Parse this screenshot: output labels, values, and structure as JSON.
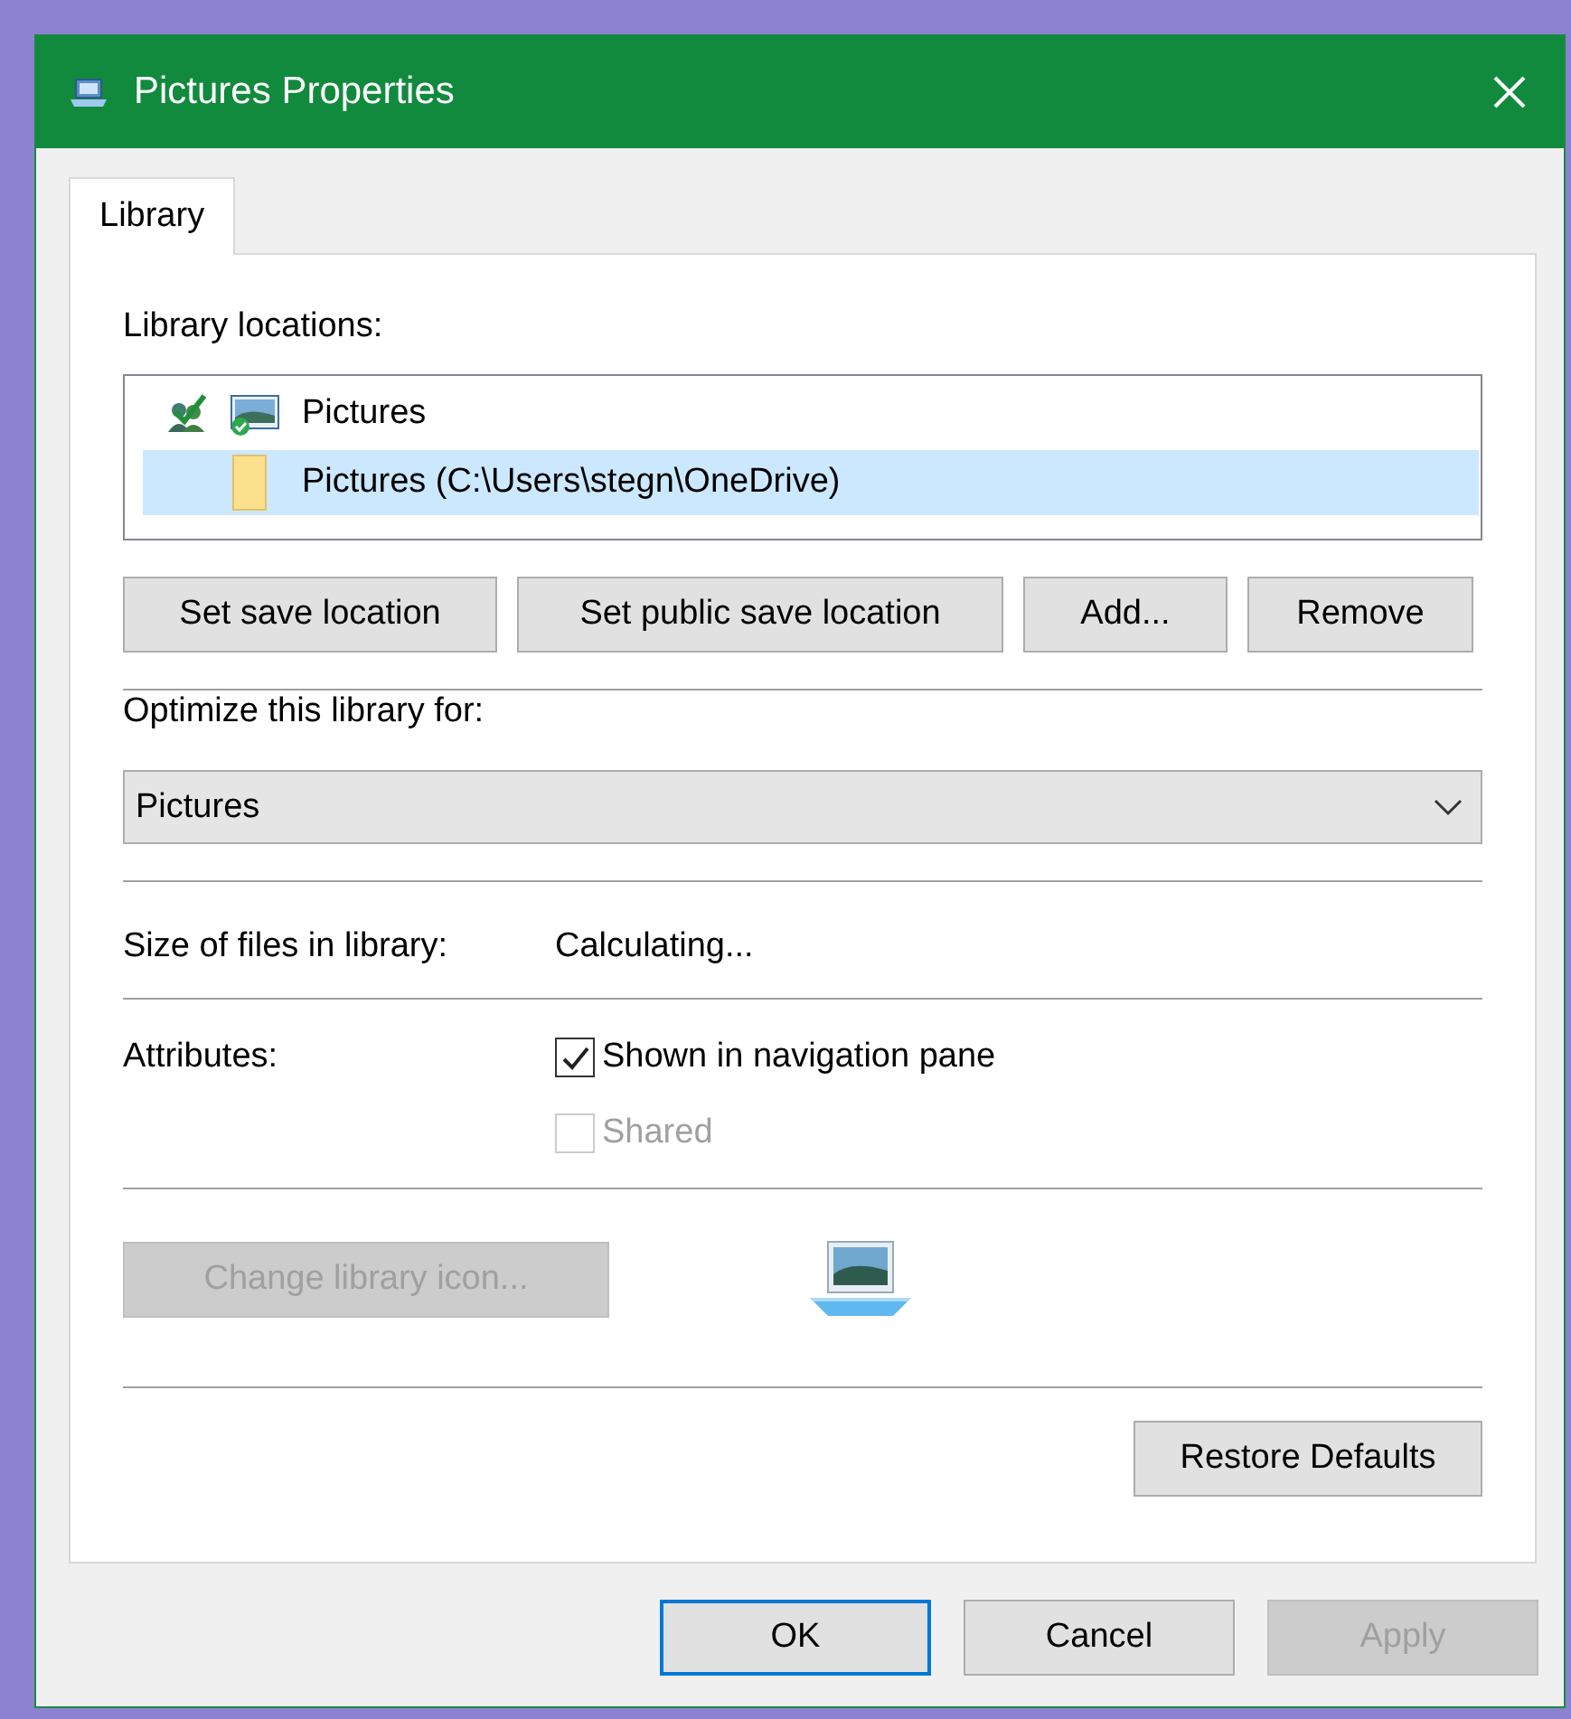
{
  "window": {
    "title": "Pictures Properties"
  },
  "tabs": [
    {
      "label": "Library",
      "selected": true
    }
  ],
  "library_locations": {
    "label": "Library locations:",
    "items": [
      {
        "label": "Pictures",
        "kind": "library",
        "save_location": true,
        "selected": false
      },
      {
        "label": "Pictures (C:\\Users\\stegn\\OneDrive)",
        "kind": "folder",
        "save_location": false,
        "selected": true
      }
    ]
  },
  "location_buttons": [
    {
      "label": "Set save location",
      "disabled": false
    },
    {
      "label": "Set public save location",
      "disabled": false
    },
    {
      "label": "Add...",
      "disabled": false
    },
    {
      "label": "Remove",
      "disabled": false
    }
  ],
  "optimize": {
    "label": "Optimize this library for:",
    "value": "Pictures"
  },
  "size": {
    "label": "Size of files in library:",
    "value": "Calculating..."
  },
  "attributes": {
    "label": "Attributes:",
    "options": [
      {
        "label": "Shown in navigation pane",
        "checked": true,
        "disabled": false
      },
      {
        "label": "Shared",
        "checked": false,
        "disabled": true
      }
    ]
  },
  "change_icon_button": {
    "label": "Change library icon...",
    "disabled": true
  },
  "restore_button": {
    "label": "Restore Defaults",
    "disabled": false
  },
  "dialog_buttons": [
    {
      "label": "OK",
      "default": true,
      "disabled": false
    },
    {
      "label": "Cancel",
      "default": false,
      "disabled": false
    },
    {
      "label": "Apply",
      "default": false,
      "disabled": true
    }
  ]
}
